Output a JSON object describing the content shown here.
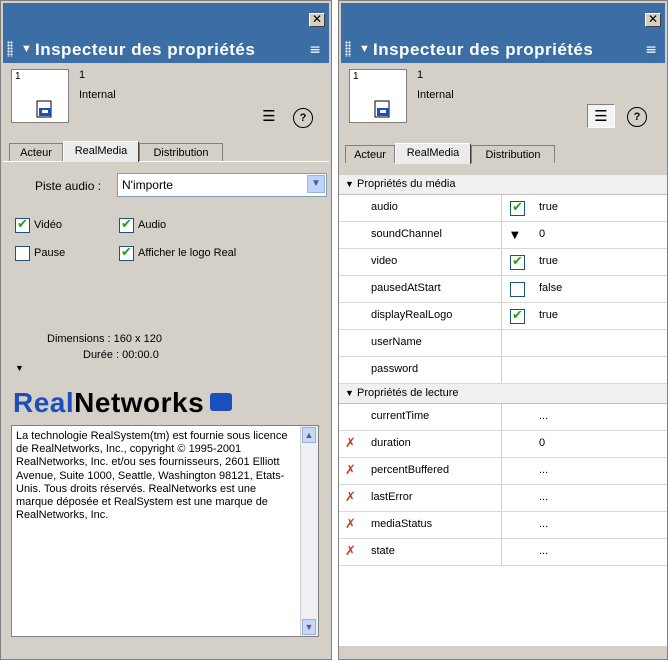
{
  "panel_title": "Inspecteur des propriétés",
  "close_glyph": "✕",
  "left": {
    "member_number": "1",
    "thumb_number": "1",
    "member_type": "Internal",
    "help_label": "?",
    "tabs": [
      "Acteur",
      "RealMedia",
      "Distribution"
    ],
    "active_tab": "RealMedia",
    "piste_audio_label": "Piste audio :",
    "piste_audio_value": "N'importe",
    "checkboxes": [
      {
        "label": "Vidéo",
        "checked": true
      },
      {
        "label": "Audio",
        "checked": true
      },
      {
        "label": "Pause",
        "checked": false
      },
      {
        "label": "Afficher le logo Real",
        "checked": true
      }
    ],
    "dimensions": "Dimensions : 160 x 120",
    "duree": "Durée : 00:00.0",
    "logo_part1": "Real",
    "logo_part2": "Networks",
    "copyright": "La technologie RealSystem(tm) est fournie sous licence de RealNetworks, Inc., copyright © 1995-2001 RealNetworks, Inc. et/ou ses fournisseurs, 2601 Elliott Avenue, Suite 1000, Seattle, Washington 98121, Etats-Unis. Tous droits réservés. RealNetworks est une marque déposée et RealSystem est une marque de RealNetworks, Inc."
  },
  "right": {
    "member_number": "1",
    "thumb_number": "1",
    "member_type": "Internal",
    "help_label": "?",
    "tabs": [
      "Acteur",
      "RealMedia",
      "Distribution"
    ],
    "active_tab": "RealMedia",
    "section1": "Propriétés du média",
    "media_props": [
      {
        "name": "audio",
        "control": "checkbox",
        "checked": true,
        "value": "true"
      },
      {
        "name": "soundChannel",
        "control": "dropdown",
        "value": "0"
      },
      {
        "name": "video",
        "control": "checkbox",
        "checked": true,
        "value": "true"
      },
      {
        "name": "pausedAtStart",
        "control": "checkbox",
        "checked": false,
        "value": "false"
      },
      {
        "name": "displayRealLogo",
        "control": "checkbox",
        "checked": true,
        "value": "true"
      },
      {
        "name": "userName",
        "control": "none",
        "value": ""
      },
      {
        "name": "password",
        "control": "none",
        "value": ""
      }
    ],
    "section2": "Propriétés de lecture",
    "playback_props": [
      {
        "name": "currentTime",
        "locked": false,
        "value": "..."
      },
      {
        "name": "duration",
        "locked": true,
        "value": "0"
      },
      {
        "name": "percentBuffered",
        "locked": true,
        "value": "..."
      },
      {
        "name": "lastError",
        "locked": true,
        "value": "..."
      },
      {
        "name": "mediaStatus",
        "locked": true,
        "value": "..."
      },
      {
        "name": "state",
        "locked": true,
        "value": "..."
      }
    ]
  }
}
